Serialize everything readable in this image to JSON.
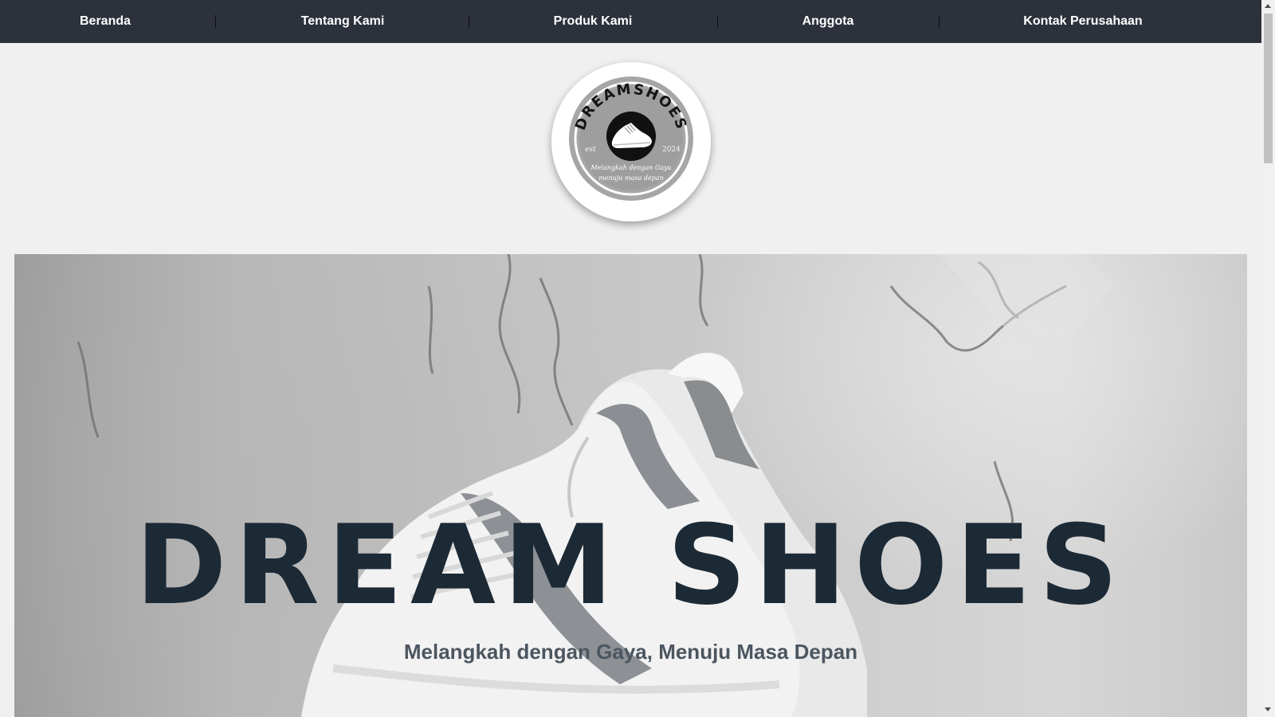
{
  "nav": {
    "items": [
      {
        "label": "Beranda"
      },
      {
        "label": "Tentang Kami"
      },
      {
        "label": "Produk Kami"
      },
      {
        "label": "Anggota"
      },
      {
        "label": "Kontak Perusahaan"
      }
    ]
  },
  "logo": {
    "brand": "DREAMSHOES",
    "est_label": "est",
    "year": "2024",
    "tagline_line1": "Melangkah dengan Gaya",
    "tagline_line2": "menuju masa depan",
    "icon": "shoe-icon"
  },
  "hero": {
    "title": "DREAM SHOES",
    "subtitle": "Melangkah dengan Gaya, Menuju Masa Depan",
    "image": "white-sneakers-against-concrete-wall"
  },
  "colors": {
    "nav_bg": "#2c313b",
    "nav_text": "#ffffff",
    "page_bg": "#f0f0f0",
    "hero_title": "#1c2a36",
    "hero_subtitle": "#4c5660"
  }
}
